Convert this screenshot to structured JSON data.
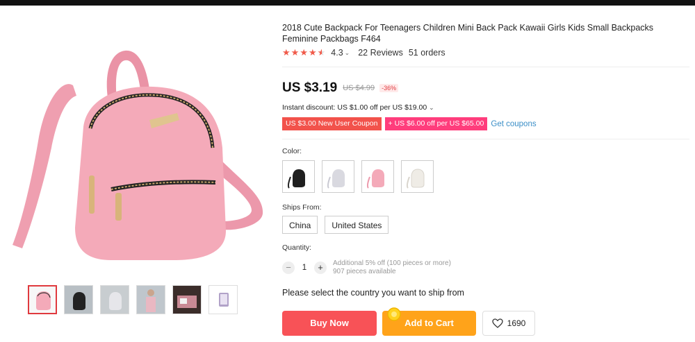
{
  "product": {
    "title": "2018 Cute Backpack For Teenagers Children Mini Back Pack Kawaii Girls Kids Small Backpacks Feminine Packbags F464",
    "rating": "4.3",
    "rating_stars": 4.3,
    "reviews": "22 Reviews",
    "orders": "51 orders",
    "price": "US $3.19",
    "old_price": "US $4.99",
    "discount": "-36%",
    "instant_discount": "Instant discount: US $1.00 off per US $19.00",
    "coupons": [
      "US $3.00 New User Coupon",
      "US $6.00 off per US $65.00"
    ],
    "coupon_prefix": "+",
    "get_coupons": "Get coupons"
  },
  "options": {
    "color_label": "Color:",
    "colors": [
      "black",
      "gray",
      "pink",
      "white"
    ],
    "ships_label": "Ships From:",
    "ships": [
      "China",
      "United States"
    ],
    "quantity_label": "Quantity:",
    "quantity_value": "1",
    "minus": "−",
    "plus": "+",
    "qty_info_line1": "Additional 5% off (100 pieces or more)",
    "qty_info_line2": "907 pieces available"
  },
  "actions": {
    "select_country": "Please select the country you want to ship from",
    "buy_now": "Buy Now",
    "add_to_cart": "Add to Cart",
    "wishlist_count": "1690"
  },
  "icons": {
    "heart": "heart-icon",
    "chevron": "chevron-down-icon",
    "star": "star-icon"
  },
  "colors": {
    "star": "#f05a4a",
    "buy_now": "#f85257",
    "add_to_cart": "#ffa31a",
    "coupon_1": "#f2524b",
    "coupon_2": "#ff3d7c",
    "link": "#3a8ec7",
    "thumb_active_border": "#e0393e"
  }
}
